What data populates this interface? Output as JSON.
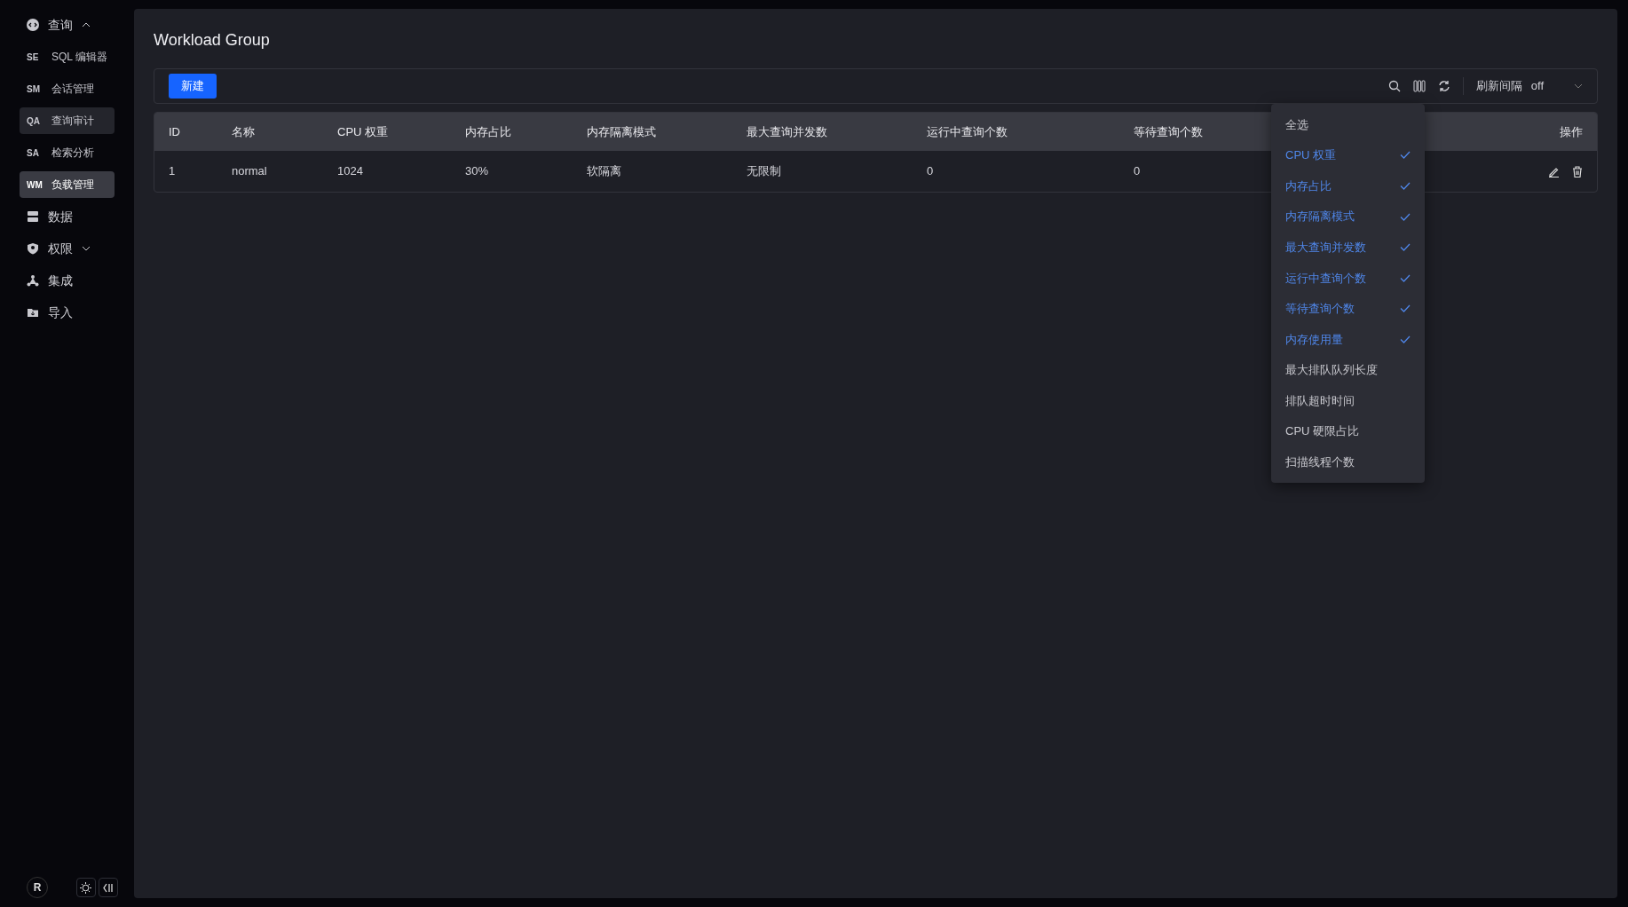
{
  "sidebar": {
    "items": [
      {
        "kind": "group",
        "label": "查询",
        "expanded": true,
        "children": [
          {
            "abbr": "SE",
            "label": "SQL 编辑器",
            "selected": false,
            "hovered": false
          },
          {
            "abbr": "SM",
            "label": "会话管理",
            "selected": false,
            "hovered": false
          },
          {
            "abbr": "QA",
            "label": "查询审计",
            "selected": false,
            "hovered": true
          },
          {
            "abbr": "SA",
            "label": "检索分析",
            "selected": false,
            "hovered": false
          },
          {
            "abbr": "WM",
            "label": "负载管理",
            "selected": true,
            "hovered": false
          }
        ]
      },
      {
        "kind": "item",
        "label": "数据"
      },
      {
        "kind": "group",
        "label": "权限",
        "expanded": false
      },
      {
        "kind": "item",
        "label": "集成"
      },
      {
        "kind": "item",
        "label": "导入"
      }
    ],
    "user_initial": "R"
  },
  "page": {
    "title": "Workload Group"
  },
  "toolbar": {
    "new_button": "新建",
    "refresh_label": "刷新间隔",
    "refresh_value": "off"
  },
  "table": {
    "columns": [
      "ID",
      "名称",
      "CPU 权重",
      "内存占比",
      "内存隔离模式",
      "最大查询并发数",
      "运行中查询个数",
      "等待查询个数",
      "操作"
    ],
    "rows": [
      [
        "1",
        "normal",
        "1024",
        "30%",
        "软隔离",
        "无限制",
        "0",
        "0"
      ]
    ]
  },
  "column_menu": {
    "select_all": "全选",
    "items": [
      {
        "label": "CPU 权重",
        "checked": true
      },
      {
        "label": "内存占比",
        "checked": true
      },
      {
        "label": "内存隔离模式",
        "checked": true
      },
      {
        "label": "最大查询并发数",
        "checked": true
      },
      {
        "label": "运行中查询个数",
        "checked": true
      },
      {
        "label": "等待查询个数",
        "checked": true
      },
      {
        "label": "内存使用量",
        "checked": true
      },
      {
        "label": "最大排队队列长度",
        "checked": false
      },
      {
        "label": "排队超时时间",
        "checked": false
      },
      {
        "label": "CPU 硬限占比",
        "checked": false
      },
      {
        "label": "扫描线程个数",
        "checked": false
      }
    ]
  }
}
